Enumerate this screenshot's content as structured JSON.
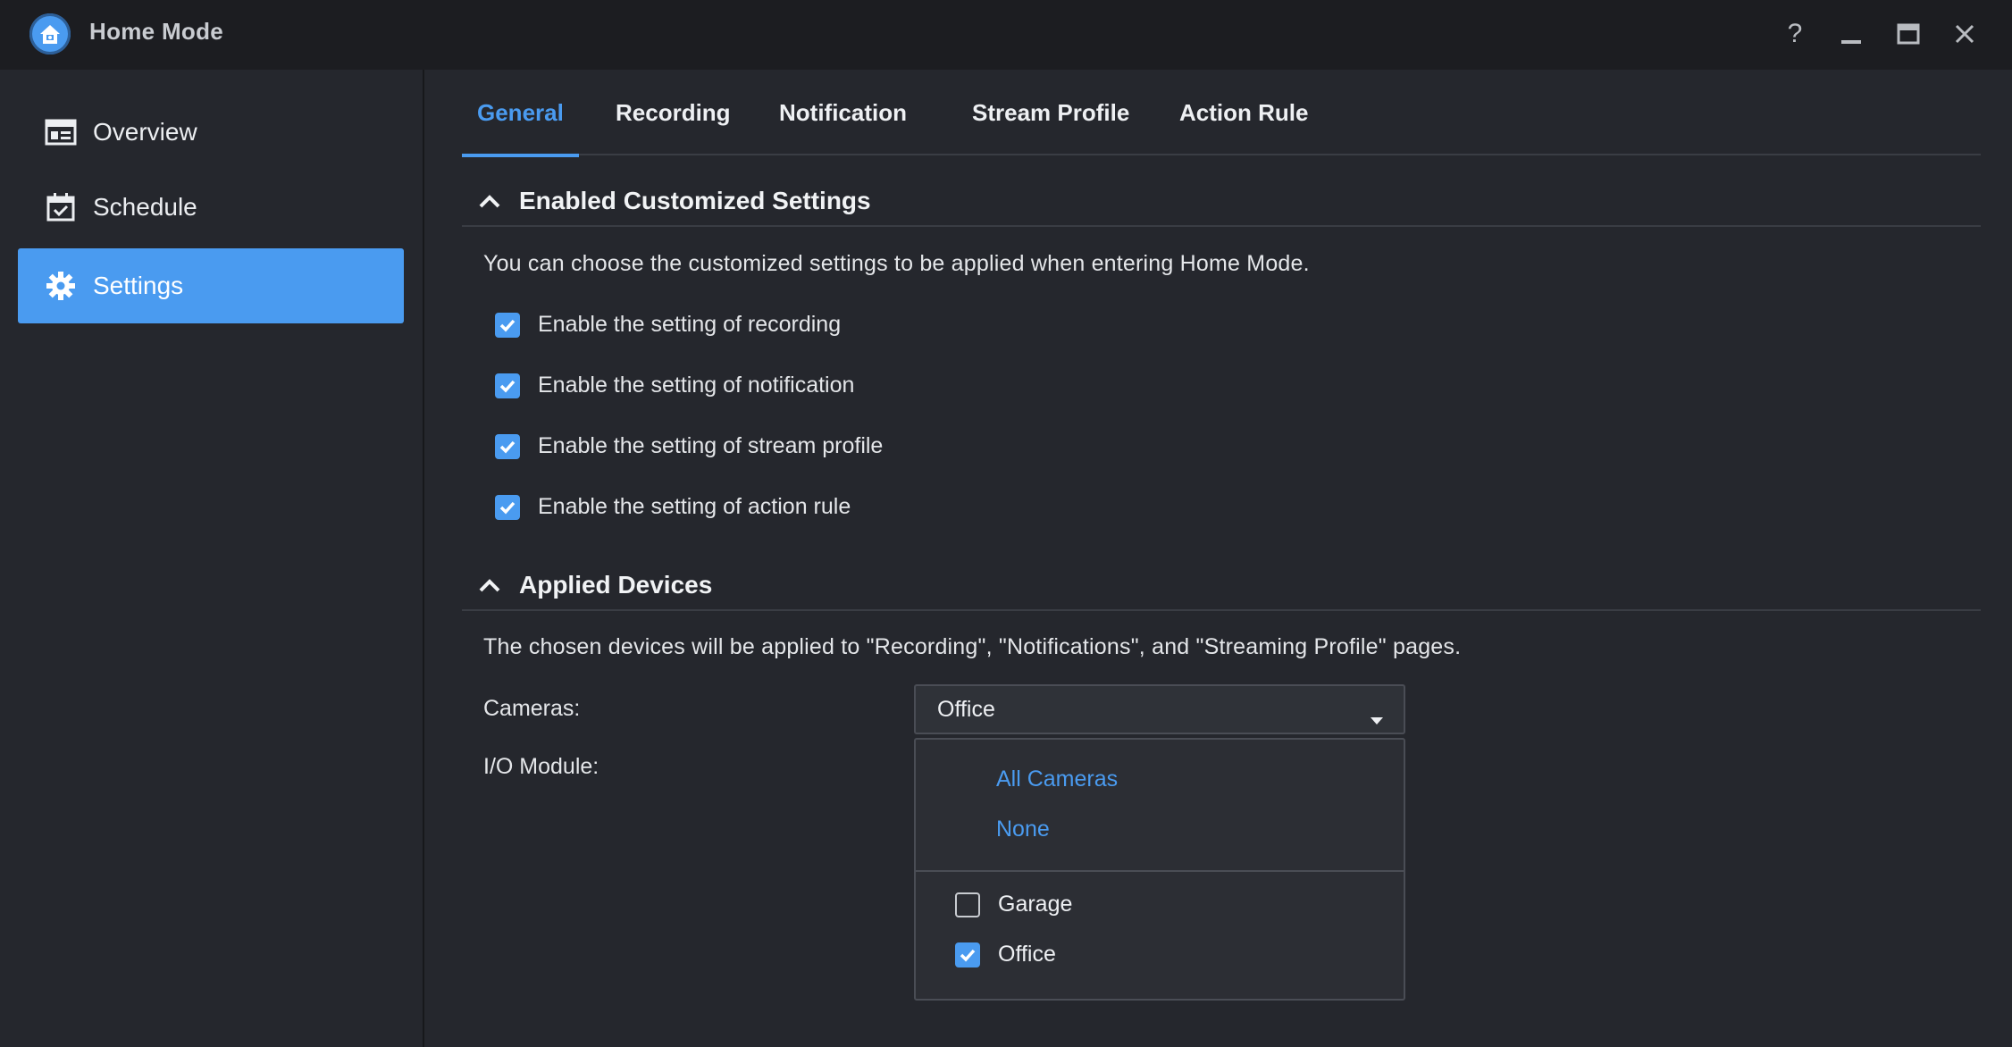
{
  "window": {
    "title": "Home Mode",
    "controls": [
      "help-icon",
      "minimize-icon",
      "maximize-icon",
      "close-icon"
    ],
    "help_glyph": "?"
  },
  "sidebar": {
    "items": [
      {
        "label": "Overview",
        "icon": "overview-icon",
        "active": false
      },
      {
        "label": "Schedule",
        "icon": "calendar-icon",
        "active": false
      },
      {
        "label": "Settings",
        "icon": "gear-icon",
        "active": true
      }
    ]
  },
  "tabs": [
    {
      "label": "General",
      "active": true
    },
    {
      "label": "Recording",
      "active": false
    },
    {
      "label": "Notification",
      "active": false
    },
    {
      "label": "Stream Profile",
      "active": false
    },
    {
      "label": "Action Rule",
      "active": false
    }
  ],
  "customized": {
    "title": "Enabled Customized Settings",
    "description": "You can choose the customized settings to be applied when entering Home Mode.",
    "options": [
      {
        "label": "Enable the setting of recording",
        "checked": true
      },
      {
        "label": "Enable the setting of notification",
        "checked": true
      },
      {
        "label": "Enable the setting of stream profile",
        "checked": true
      },
      {
        "label": "Enable the setting of action rule",
        "checked": true
      }
    ]
  },
  "devices": {
    "title": "Applied Devices",
    "description": "The chosen devices will be applied to \"Recording\", \"Notifications\", and \"Streaming Profile\" pages.",
    "cameras_label": "Cameras:",
    "io_label": "I/O Module:",
    "cameras_value": "Office",
    "dropdown": {
      "all_label": "All Cameras",
      "none_label": "None",
      "items": [
        {
          "label": "Garage",
          "checked": false
        },
        {
          "label": "Office",
          "checked": true
        }
      ]
    }
  },
  "colors": {
    "accent": "#4a9bf0",
    "background": "#25272d",
    "titlebar": "#1c1d21"
  }
}
